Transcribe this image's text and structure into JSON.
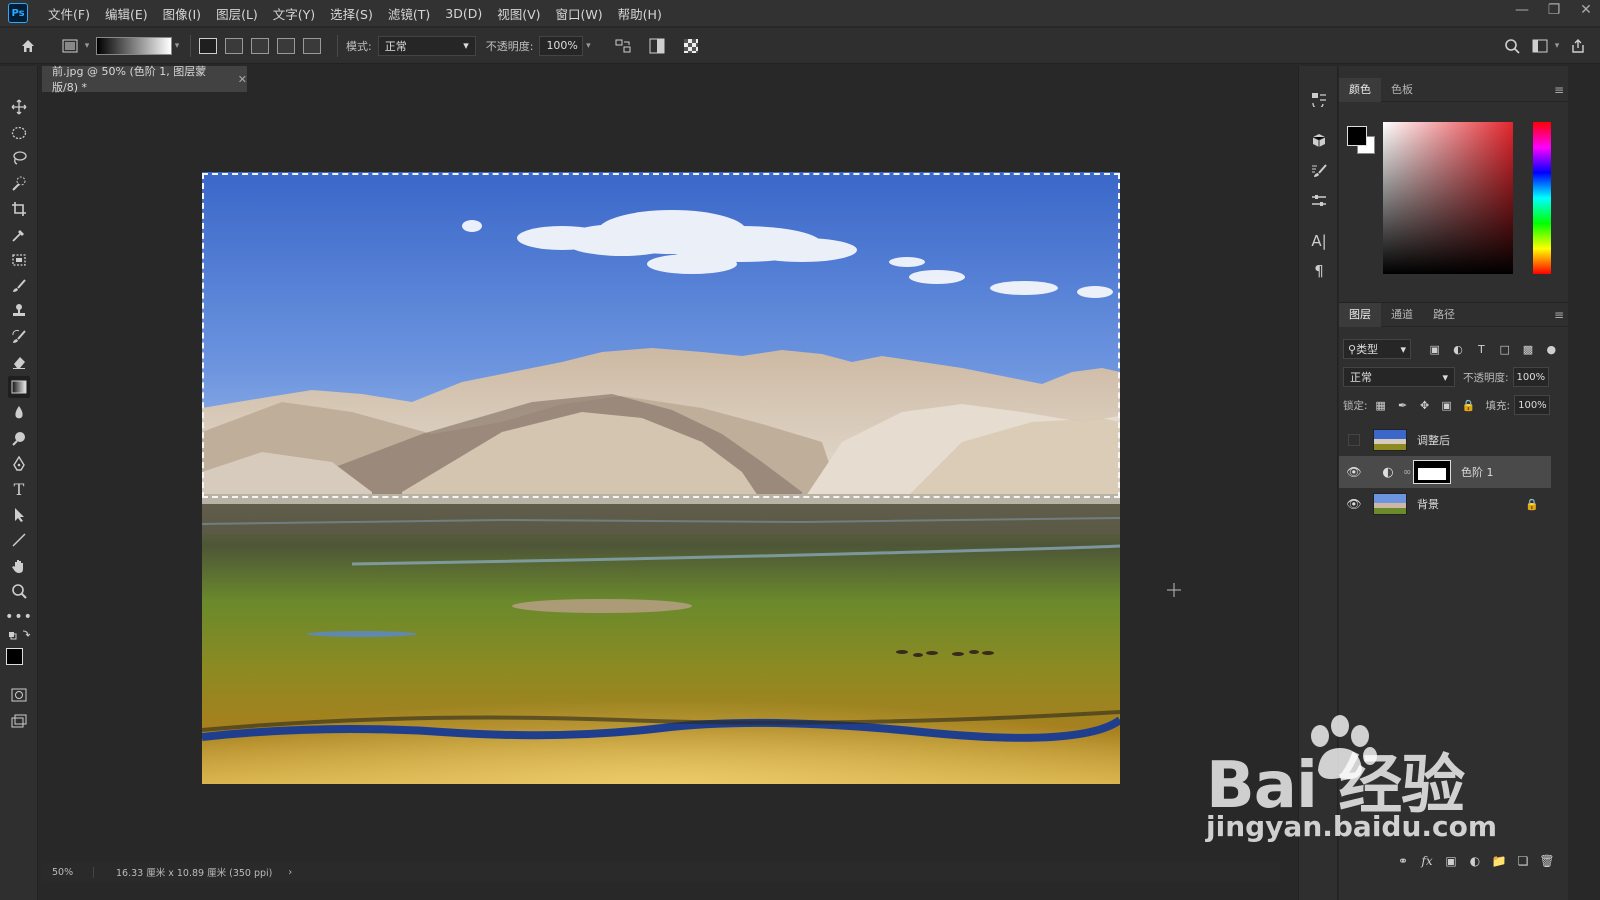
{
  "app": {
    "logo": "Ps"
  },
  "menu": [
    "文件(F)",
    "编辑(E)",
    "图像(I)",
    "图层(L)",
    "文字(Y)",
    "选择(S)",
    "滤镜(T)",
    "3D(D)",
    "视图(V)",
    "窗口(W)",
    "帮助(H)"
  ],
  "options": {
    "mode_label": "模式:",
    "mode_value": "正常",
    "opacity_label": "不透明度:",
    "opacity_value": "100%"
  },
  "document": {
    "tab_title": "前.jpg @ 50% (色阶 1, 图层蒙版/8) *",
    "zoom": "50%",
    "doc_info": "16.33 厘米 x 10.89 厘米 (350 ppi)"
  },
  "color_panel": {
    "tabs": [
      "颜色",
      "色板"
    ],
    "fg_color": "#000000",
    "bg_color": "#ffffff"
  },
  "layers_panel": {
    "tabs": [
      "图层",
      "通道",
      "路径"
    ],
    "filter_label": "类型",
    "blend_mode": "正常",
    "opacity_label": "不透明度:",
    "opacity_value": "100%",
    "lock_label": "锁定:",
    "fill_label": "填充:",
    "fill_value": "100%",
    "layers": [
      {
        "name": "调整后",
        "visible": false
      },
      {
        "name": "色阶 1",
        "visible": true,
        "selected": true
      },
      {
        "name": "背景",
        "visible": true,
        "locked": true
      }
    ]
  },
  "watermark": {
    "brand": "Bai  经验",
    "url": "jingyan.baidu.com"
  }
}
